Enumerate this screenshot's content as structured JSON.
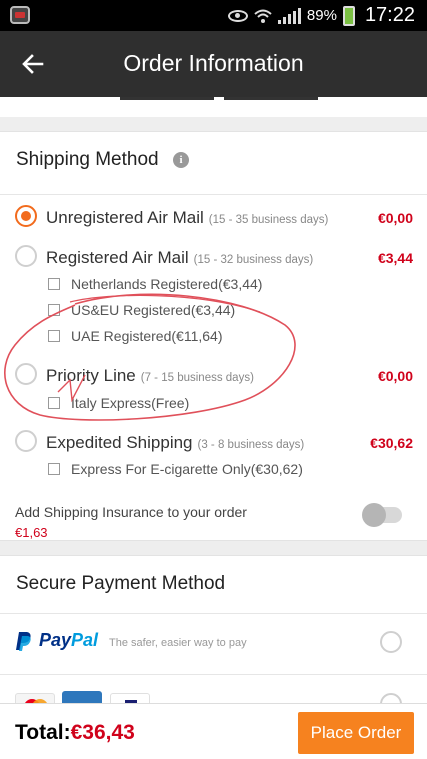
{
  "status_bar": {
    "battery": "89%",
    "time": "17:22"
  },
  "header": {
    "title": "Order Information",
    "back_icon": "arrow-left-icon"
  },
  "shipping": {
    "title": "Shipping Method",
    "methods": [
      {
        "name": "Unregistered Air Mail",
        "days": "(15 - 35 business days)",
        "price": "€0,00",
        "selected": true
      },
      {
        "name": "Registered Air Mail",
        "days": "(15 - 32 business days)",
        "price": "€3,44",
        "selected": false,
        "options": [
          "Netherlands Registered(€3,44)",
          "US&EU Registered(€3,44)",
          "UAE Registered(€11,64)"
        ]
      },
      {
        "name": "Priority Line",
        "days": "(7 - 15 business days)",
        "price": "€0,00",
        "selected": false,
        "options": [
          "Italy Express(Free)"
        ]
      },
      {
        "name": "Expedited Shipping",
        "days": "(3 - 8 business days)",
        "price": "€30,62",
        "selected": false,
        "options": [
          "Express For E-cigarette Only(€30,62)"
        ]
      }
    ],
    "insurance_label": "Add Shipping Insurance to your order",
    "insurance_price": "€1,63",
    "insurance_enabled": false
  },
  "payment": {
    "title": "Secure Payment Method",
    "paypal_brand_pay": "Pay",
    "paypal_brand_pal": "Pal",
    "paypal_desc": "The safer, easier way to pay"
  },
  "footer": {
    "total_label": "Total:",
    "total_value": "€36,43",
    "place_order": "Place Order"
  },
  "colors": {
    "accent": "#f6821f",
    "price": "#d0021b",
    "appbar": "#2f2f2f",
    "annotation": "#e0505a"
  }
}
